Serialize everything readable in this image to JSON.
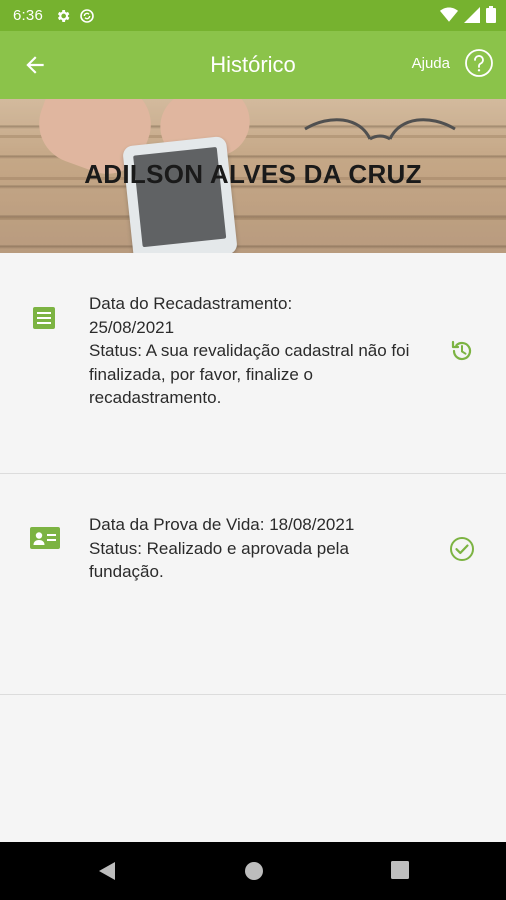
{
  "status_bar": {
    "time": "6:36",
    "icons": [
      "gear-icon",
      "sync-icon",
      "wifi-icon",
      "cellular-signal-icon",
      "battery-icon"
    ]
  },
  "app_bar": {
    "title": "Histórico",
    "help_label": "Ajuda",
    "back_icon": "arrow-left-icon",
    "help_icon": "question-circle-icon"
  },
  "banner": {
    "name": "ADILSON ALVES DA CRUZ"
  },
  "history": [
    {
      "icon": "document-list-icon",
      "line1": "Data do Recadastramento:",
      "line2": "25/08/2021",
      "status": "Status: A sua revalidação cadastral não foi finalizada, por favor, finalize o recadastramento.",
      "status_icon": "history-refresh-icon"
    },
    {
      "icon": "id-card-icon",
      "line1": "Data da Prova de Vida: 18/08/2021",
      "status": "Status: Realizado e aprovada pela fundação.",
      "status_icon": "check-circle-icon"
    }
  ],
  "colors": {
    "status_bar": "#76b22f",
    "app_bar": "#8bc34a",
    "accent": "#7cb342",
    "background": "#f5f5f5"
  },
  "nav_bar": {
    "icons": [
      "back-triangle-icon",
      "home-circle-icon",
      "recents-square-icon"
    ]
  }
}
